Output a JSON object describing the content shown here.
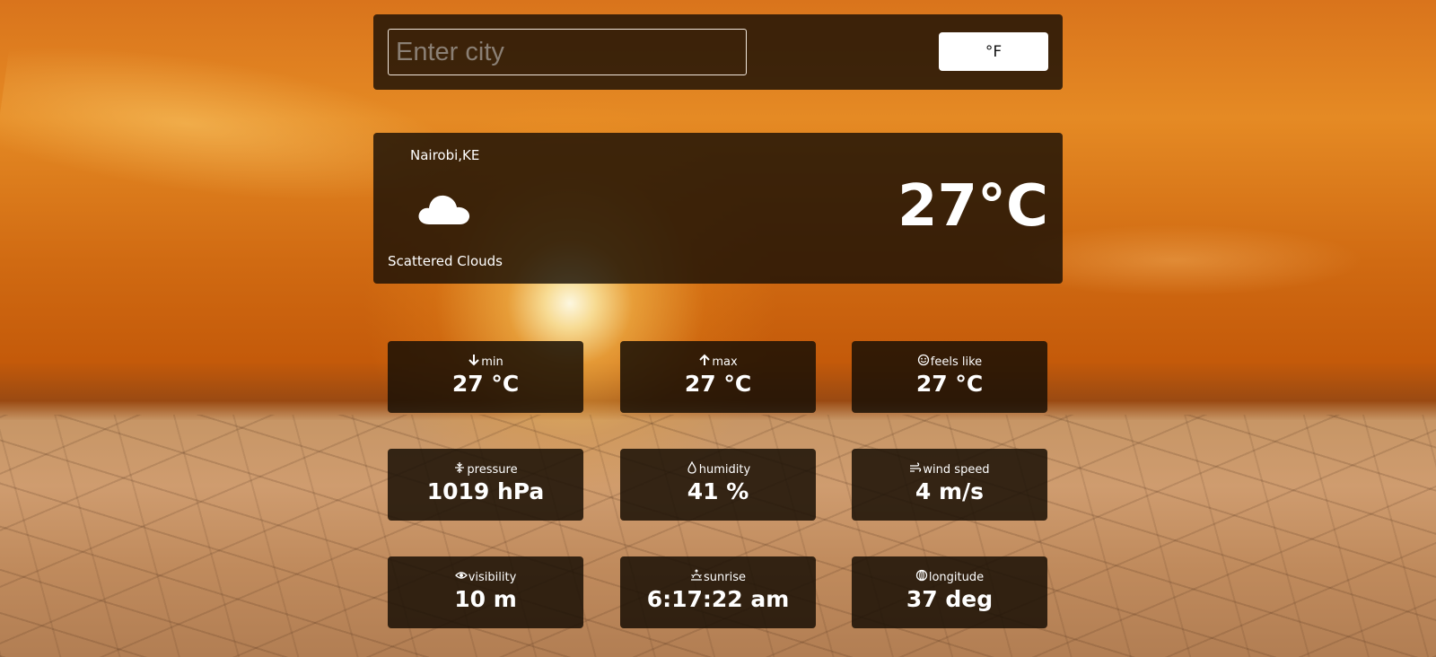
{
  "search": {
    "placeholder": "Enter city",
    "value": "",
    "unit_toggle_label": "°F"
  },
  "current": {
    "location": "Nairobi,KE",
    "condition_icon": "cloud-icon",
    "description": "Scattered Clouds",
    "temperature": "27°C"
  },
  "stats": [
    {
      "label": "min",
      "value": "27 °C",
      "icon": "arrow-down-icon"
    },
    {
      "label": "max",
      "value": "27 °C",
      "icon": "arrow-up-icon"
    },
    {
      "label": "feels like",
      "value": "27 °C",
      "icon": "smiley-icon"
    },
    {
      "label": "pressure",
      "value": "1019 hPa",
      "icon": "pressure-icon"
    },
    {
      "label": "humidity",
      "value": "41 %",
      "icon": "droplet-icon"
    },
    {
      "label": "wind speed",
      "value": "4 m/s",
      "icon": "wind-icon"
    },
    {
      "label": "visibility",
      "value": "10 m",
      "icon": "eye-icon"
    },
    {
      "label": "sunrise",
      "value": "6:17:22 am",
      "icon": "sunrise-icon"
    },
    {
      "label": "longitude",
      "value": "37 deg",
      "icon": "globe-icon"
    }
  ]
}
